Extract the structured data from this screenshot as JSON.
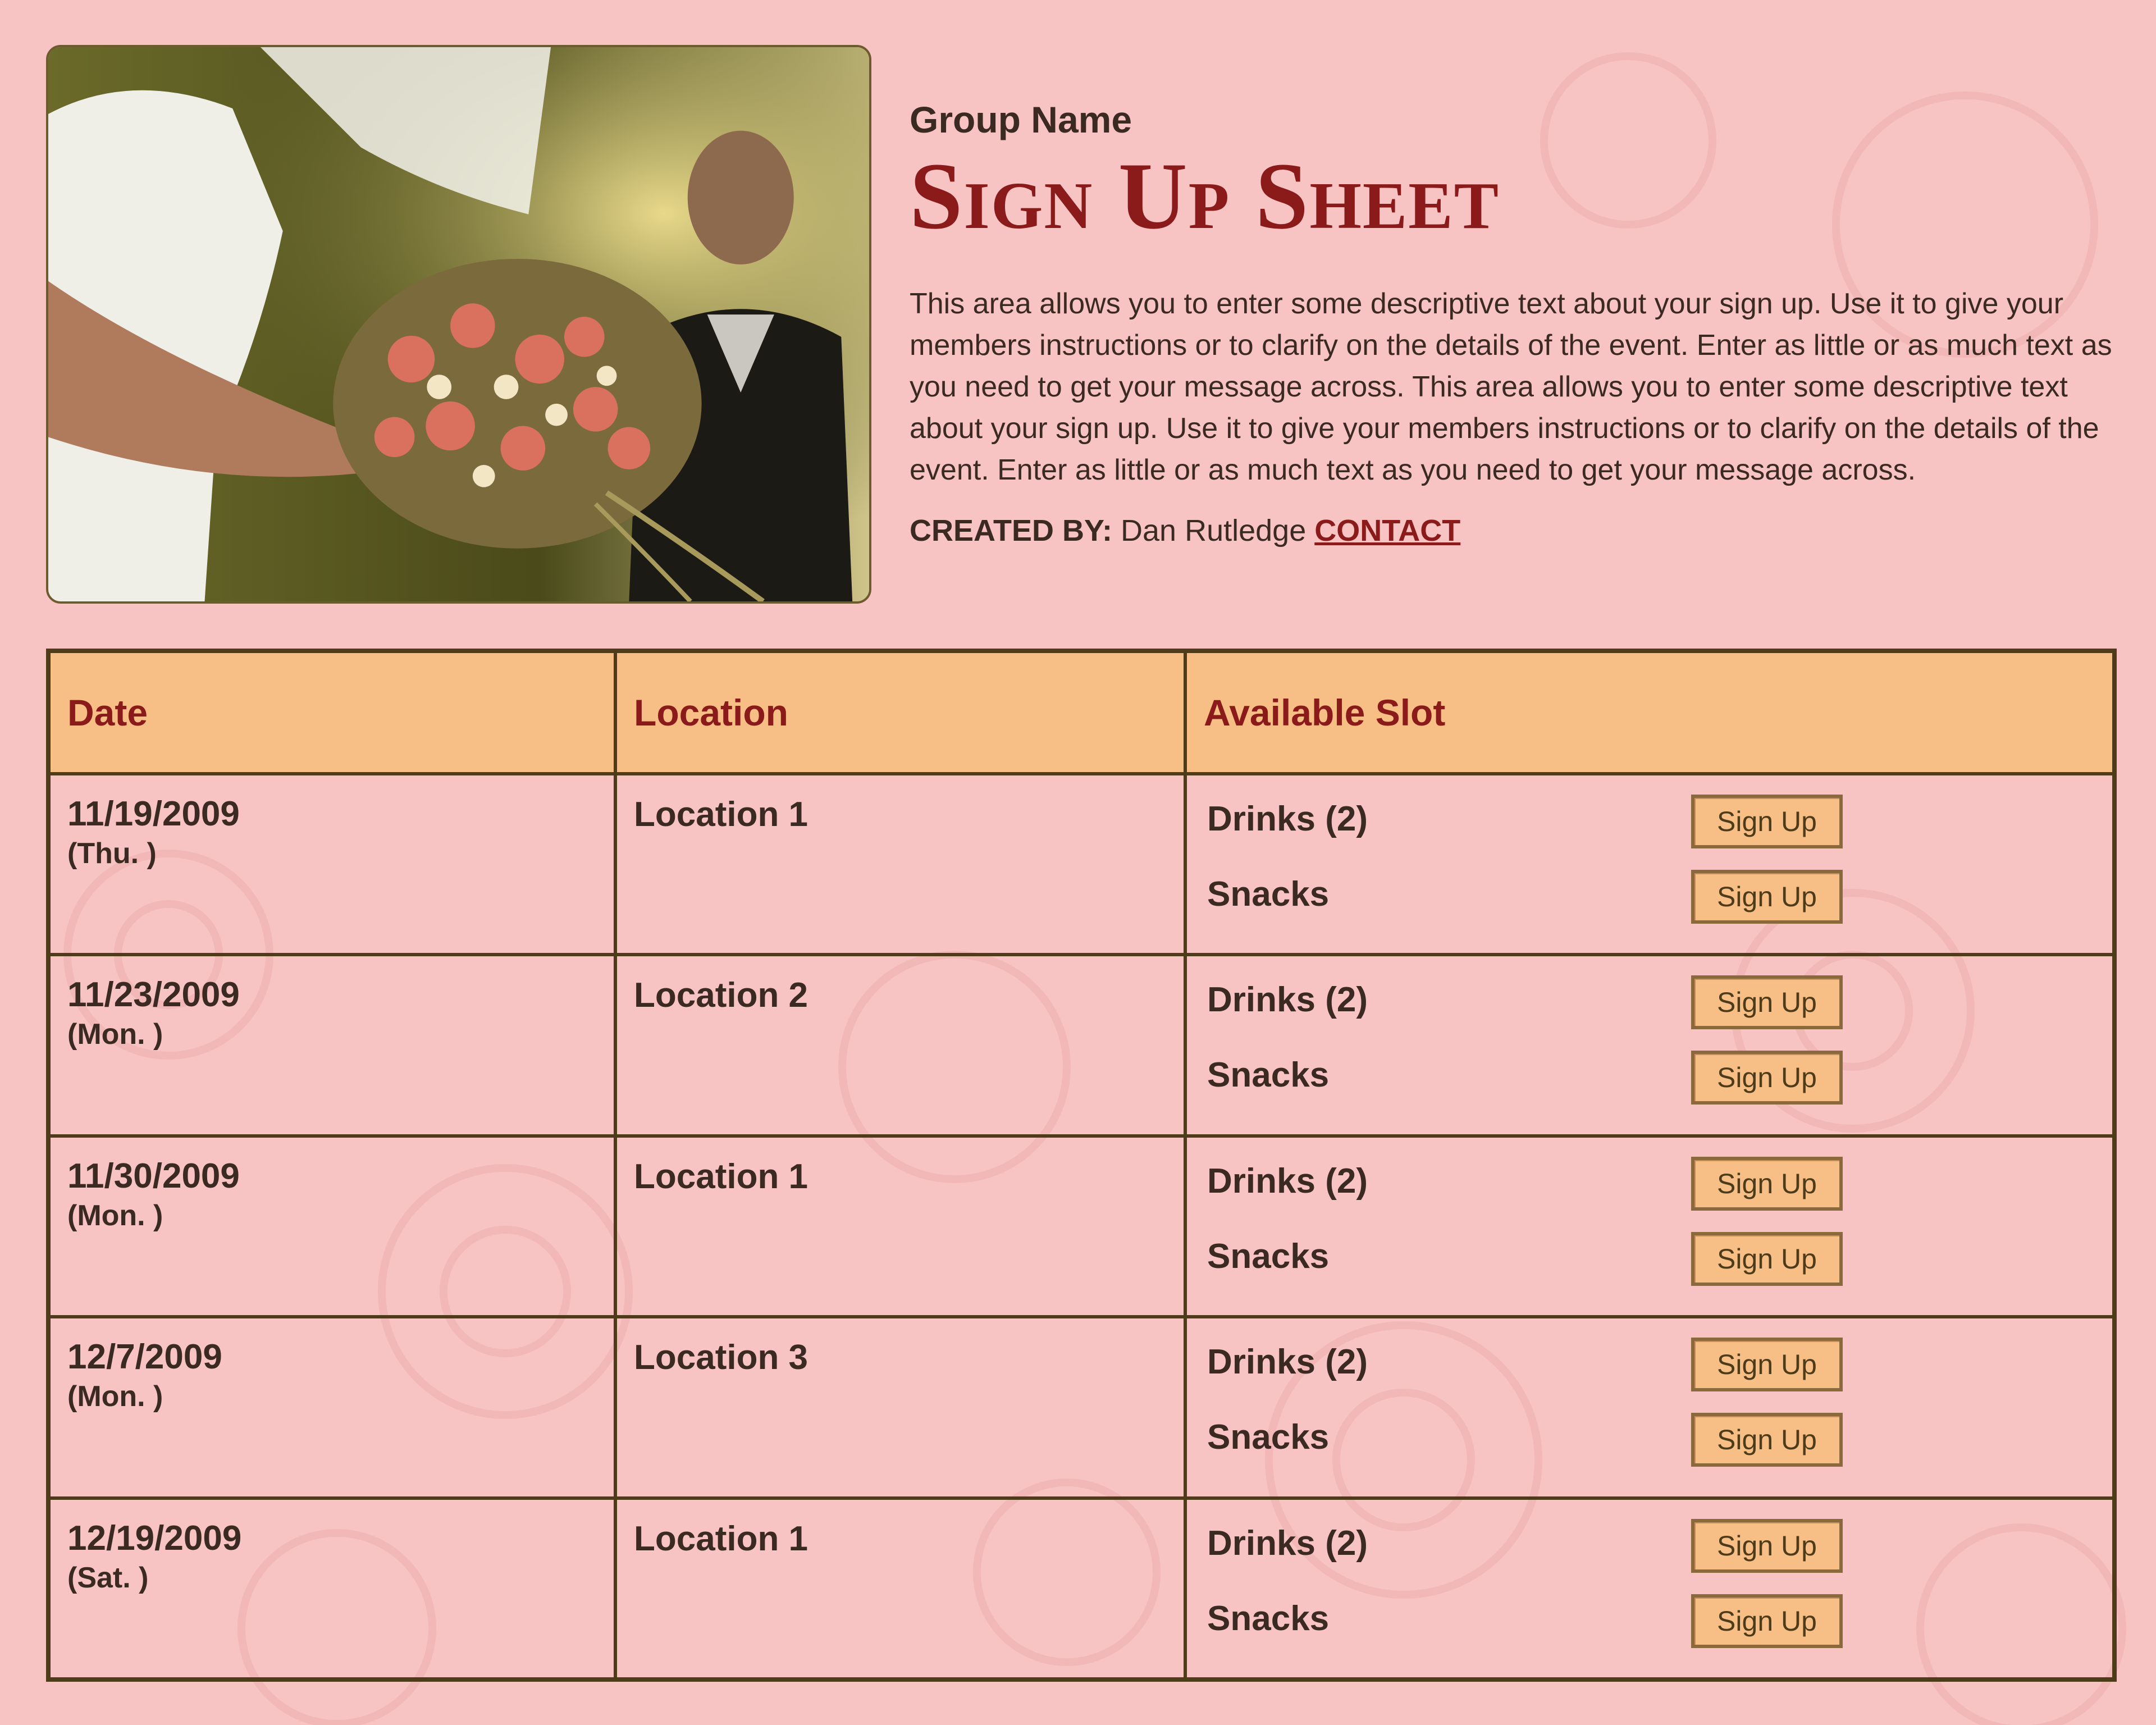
{
  "header": {
    "group_name": "Group Name",
    "title": "Sign Up Sheet",
    "description": "This area allows you to enter some descriptive text about your sign up. Use it to give your members instructions or to clarify on the details of the event. Enter as little or as much text as you need to get your message across. This area allows you to enter some descriptive text about your sign up. Use it to give your members instructions or to clarify on the details of the event. Enter as little or as much text as you need to get your message across.",
    "created_by_label": "CREATED BY:",
    "created_by_name": "Dan Rutledge",
    "contact_label": "CONTACT"
  },
  "table": {
    "columns": [
      "Date",
      "Location",
      "Available Slot"
    ],
    "button_label": "Sign Up",
    "rows": [
      {
        "date": "11/19/2009",
        "day": "(Thu. )",
        "location": "Location 1",
        "slots": [
          "Drinks (2)",
          "Snacks"
        ]
      },
      {
        "date": "11/23/2009",
        "day": "(Mon. )",
        "location": "Location 2",
        "slots": [
          "Drinks (2)",
          "Snacks"
        ]
      },
      {
        "date": "11/30/2009",
        "day": "(Mon. )",
        "location": "Location 1",
        "slots": [
          "Drinks (2)",
          "Snacks"
        ]
      },
      {
        "date": "12/7/2009",
        "day": "(Mon. )",
        "location": "Location 3",
        "slots": [
          "Drinks (2)",
          "Snacks"
        ]
      },
      {
        "date": "12/19/2009",
        "day": "(Sat. )",
        "location": "Location 1",
        "slots": [
          "Drinks (2)",
          "Snacks"
        ]
      }
    ]
  },
  "colors": {
    "background": "#f7c3c3",
    "title": "#8b1a1a",
    "header_row": "#f7bf86",
    "border": "#4e3b1a"
  }
}
